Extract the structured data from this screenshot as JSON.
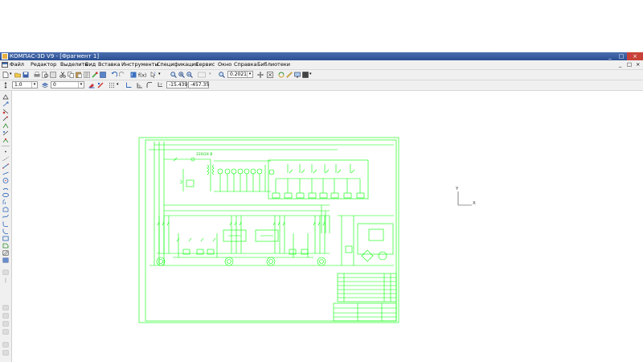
{
  "window": {
    "title": "КОМПАС-3D V9 - [Фрагмент 1]",
    "buttons": [
      "_",
      "□",
      "×"
    ]
  },
  "menu": {
    "items": [
      "Файл",
      "Редактор",
      "Выделить",
      "Вид",
      "Вставка",
      "Инструменты",
      "Спецификация",
      "Сервис",
      "Окно",
      "Справка",
      "Библиотеки"
    ]
  },
  "toolbar1": {
    "zoom_value": "0.2021"
  },
  "toolbar2": {
    "step_value": "1.0",
    "layer_value": "0",
    "coord_x": "-15.439",
    "coord_y": "-457.35"
  },
  "drawing": {
    "voltage_label": "220/24 В",
    "axis_y": "Y",
    "axis_x": "X"
  },
  "colors": {
    "accent": "#00ff00",
    "titlebar": "#2b4f92",
    "toolbar_bg": "#f0f0f0"
  }
}
